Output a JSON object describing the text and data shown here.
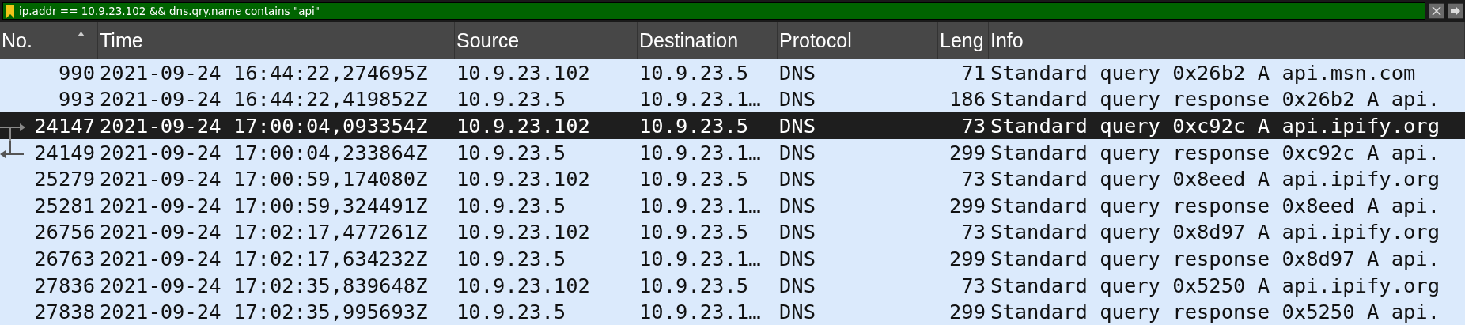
{
  "filter": {
    "value": "ip.addr == 10.9.23.102 && dns.qry.name contains \"api\"",
    "valid": true
  },
  "columns": [
    {
      "label": "No.",
      "sorted": true
    },
    {
      "label": "Time",
      "sorted": false
    },
    {
      "label": "Source",
      "sorted": false
    },
    {
      "label": "Destination",
      "sorted": false
    },
    {
      "label": "Protocol",
      "sorted": false
    },
    {
      "label": "Leng",
      "sorted": false
    },
    {
      "label": "Info",
      "sorted": false
    }
  ],
  "rows": [
    {
      "selected": false,
      "kind": "plain",
      "cells": [
        "990",
        "2021-09-24 16:44:22,274695Z",
        "10.9.23.102",
        "10.9.23.5",
        "DNS",
        "71",
        "Standard query 0x26b2 A api.msn.com"
      ]
    },
    {
      "selected": false,
      "kind": "plain",
      "cells": [
        "993",
        "2021-09-24 16:44:22,419852Z",
        "10.9.23.5",
        "10.9.23.1…",
        "DNS",
        "186",
        "Standard query response 0x26b2 A api."
      ]
    },
    {
      "selected": true,
      "kind": "request",
      "cells": [
        "24147",
        "2021-09-24 17:00:04,093354Z",
        "10.9.23.102",
        "10.9.23.5",
        "DNS",
        "73",
        "Standard query 0xc92c A api.ipify.org"
      ]
    },
    {
      "selected": false,
      "kind": "response",
      "cells": [
        "24149",
        "2021-09-24 17:00:04,233864Z",
        "10.9.23.5",
        "10.9.23.1…",
        "DNS",
        "299",
        "Standard query response 0xc92c A api."
      ]
    },
    {
      "selected": false,
      "kind": "plain",
      "cells": [
        "25279",
        "2021-09-24 17:00:59,174080Z",
        "10.9.23.102",
        "10.9.23.5",
        "DNS",
        "73",
        "Standard query 0x8eed A api.ipify.org"
      ]
    },
    {
      "selected": false,
      "kind": "plain",
      "cells": [
        "25281",
        "2021-09-24 17:00:59,324491Z",
        "10.9.23.5",
        "10.9.23.1…",
        "DNS",
        "299",
        "Standard query response 0x8eed A api."
      ]
    },
    {
      "selected": false,
      "kind": "plain",
      "cells": [
        "26756",
        "2021-09-24 17:02:17,477261Z",
        "10.9.23.102",
        "10.9.23.5",
        "DNS",
        "73",
        "Standard query 0x8d97 A api.ipify.org"
      ]
    },
    {
      "selected": false,
      "kind": "plain",
      "cells": [
        "26763",
        "2021-09-24 17:02:17,634232Z",
        "10.9.23.5",
        "10.9.23.1…",
        "DNS",
        "299",
        "Standard query response 0x8d97 A api."
      ]
    },
    {
      "selected": false,
      "kind": "plain",
      "cells": [
        "27836",
        "2021-09-24 17:02:35,839648Z",
        "10.9.23.102",
        "10.9.23.5",
        "DNS",
        "73",
        "Standard query 0x5250 A api.ipify.org"
      ]
    },
    {
      "selected": false,
      "kind": "plain",
      "cells": [
        "27838",
        "2021-09-24 17:02:35,995693Z",
        "10.9.23.5",
        "10.9.23.1…",
        "DNS",
        "299",
        "Standard query response 0x5250 A api."
      ]
    }
  ]
}
